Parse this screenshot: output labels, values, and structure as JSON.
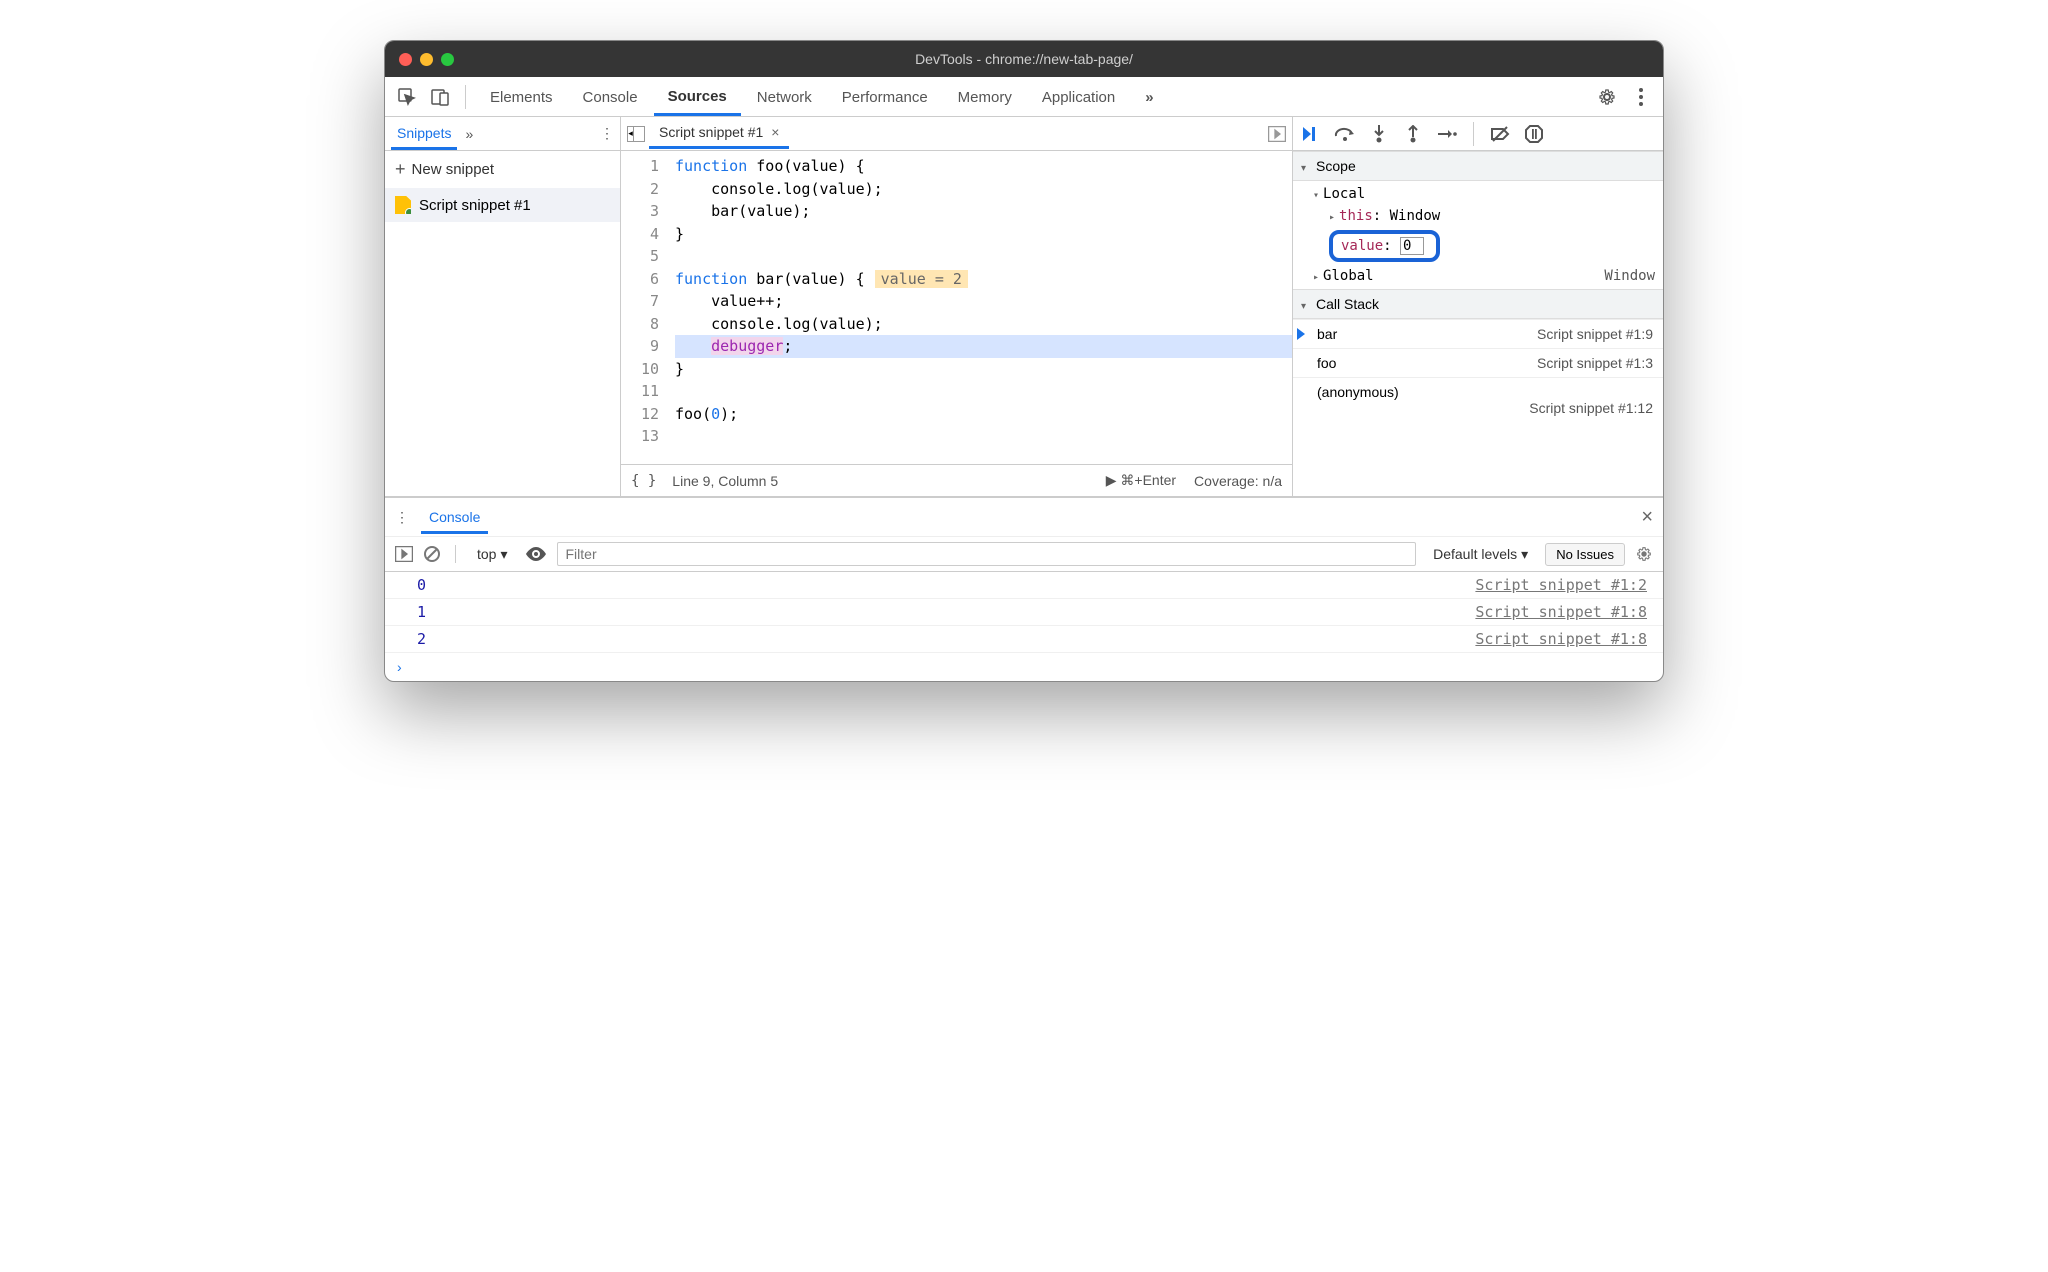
{
  "window": {
    "title": "DevTools - chrome://new-tab-page/"
  },
  "mainTabs": {
    "items": [
      "Elements",
      "Console",
      "Sources",
      "Network",
      "Performance",
      "Memory",
      "Application"
    ],
    "activeIndex": 2
  },
  "leftPane": {
    "activeTab": "Snippets",
    "newSnippet": "New snippet",
    "items": [
      "Script snippet #1"
    ]
  },
  "editor": {
    "openFile": "Script snippet #1",
    "lines": [
      "function foo(value) {",
      "    console.log(value);",
      "    bar(value);",
      "}",
      "",
      "function bar(value) {",
      "    value++;",
      "    console.log(value);",
      "    debugger;",
      "}",
      "",
      "foo(0);",
      ""
    ],
    "executingLine": 9,
    "inlineHints": {
      "6": "value = 2"
    }
  },
  "status": {
    "cursor": "Line 9, Column 5",
    "runHint": "⌘+Enter",
    "coverage": "Coverage: n/a"
  },
  "debugPane": {
    "scopeTitle": "Scope",
    "local": {
      "label": "Local",
      "thisLabel": "this",
      "thisValue": "Window",
      "valueLabel": "value",
      "valueInput": "0"
    },
    "global": {
      "label": "Global",
      "value": "Window"
    },
    "callStackTitle": "Call Stack",
    "stack": [
      {
        "name": "bar",
        "loc": "Script snippet #1:9",
        "current": true
      },
      {
        "name": "foo",
        "loc": "Script snippet #1:3",
        "current": false
      },
      {
        "name": "(anonymous)",
        "loc": "Script snippet #1:12",
        "current": false,
        "split": true
      }
    ]
  },
  "drawer": {
    "tab": "Console",
    "context": "top",
    "filterPlaceholder": "Filter",
    "levels": "Default levels",
    "issues": "No Issues",
    "logs": [
      {
        "val": "0",
        "loc": "Script snippet #1:2"
      },
      {
        "val": "1",
        "loc": "Script snippet #1:8"
      },
      {
        "val": "2",
        "loc": "Script snippet #1:8"
      }
    ]
  }
}
